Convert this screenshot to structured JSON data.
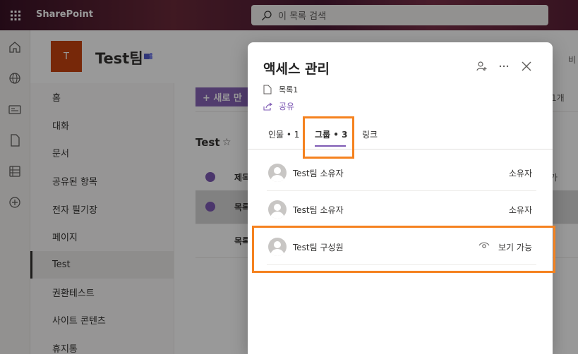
{
  "suite": {
    "brand": "SharePoint",
    "search_placeholder": "이 목록 검색"
  },
  "site": {
    "logo_letter": "T",
    "name": "Test팀",
    "header_right": "비"
  },
  "nav": {
    "items": [
      {
        "label": "홈"
      },
      {
        "label": "대화"
      },
      {
        "label": "문서"
      },
      {
        "label": "공유된 항목"
      },
      {
        "label": "전자 필기장"
      },
      {
        "label": "페이지"
      },
      {
        "label": "Test"
      },
      {
        "label": "권환테스트"
      },
      {
        "label": "사이트 콘텐츠"
      },
      {
        "label": "휴지통"
      }
    ]
  },
  "list": {
    "new_button": "+ 새로 만",
    "title": "Test",
    "column_title": "제목",
    "rows": [
      "목록",
      "목록"
    ],
    "count": "1개",
    "col_right": "가"
  },
  "panel": {
    "title": "액세스 관리",
    "file_name": "목록1",
    "share_label": "공유",
    "tabs": [
      {
        "label": "인물 • 1"
      },
      {
        "label": "그룹 • 3"
      },
      {
        "label": "링크"
      }
    ],
    "groups": [
      {
        "name": "Test팀 소유자",
        "role": "소유자"
      },
      {
        "name": "Test팀 소유자",
        "role": "소유자"
      },
      {
        "name": "Test팀 구성원",
        "role": "보기 가능"
      }
    ]
  },
  "colors": {
    "accent": "#7e5ab4",
    "highlight": "#f5821f",
    "logo_bg": "#c7430f"
  },
  "icons": [
    "waffle-icon",
    "search-icon",
    "home-icon",
    "globe-icon",
    "news-icon",
    "file-icon",
    "list-icon",
    "add-icon",
    "teams-icon",
    "star-icon",
    "person-add-icon",
    "more-icon",
    "close-icon",
    "document-icon",
    "share-icon",
    "eye-icon",
    "avatar-icon"
  ]
}
